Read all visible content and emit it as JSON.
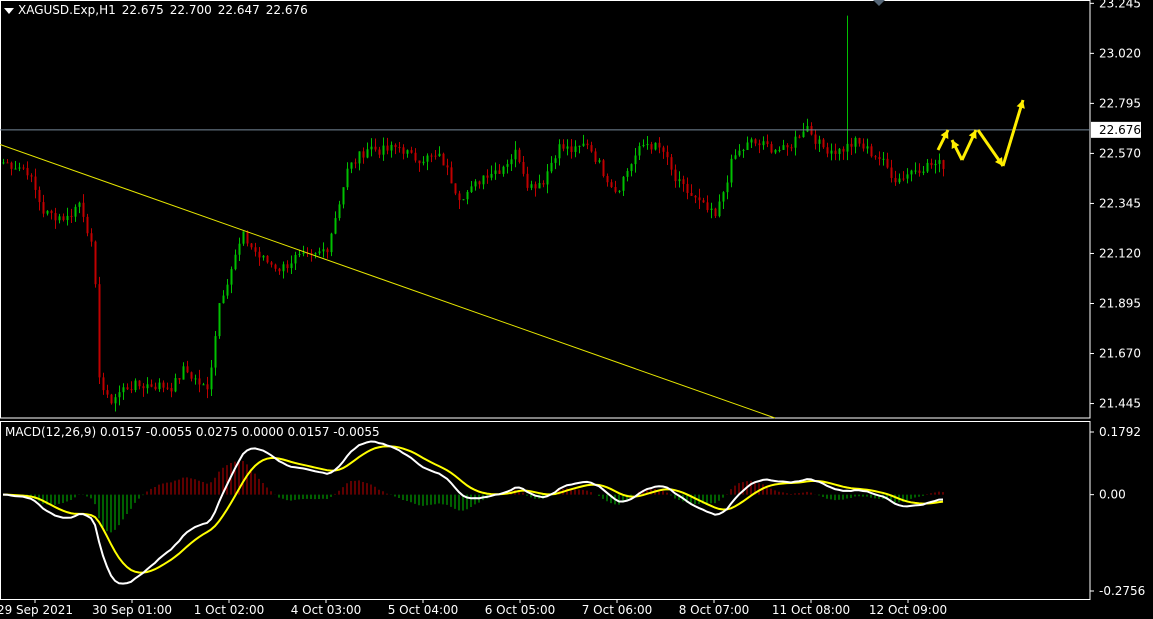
{
  "header": {
    "symbol": "XAGUSD.Exp,H1",
    "open": "22.675",
    "high": "22.700",
    "low": "22.647",
    "close": "22.676"
  },
  "macd_header": "MACD(12,26,9) 0.0157 -0.0055 0.0275 0.0000 0.0157 -0.0055",
  "colors": {
    "background": "#000000",
    "bull": "#00c000",
    "bear": "#c00000",
    "grid": "#ffffff",
    "trendline": "#e6e600",
    "signal": "#ffff00",
    "macd_line": "#ffffff",
    "price_line": "#778899",
    "arrow": "#ffee00"
  },
  "chart_data": [
    {
      "type": "candlestick",
      "title": "XAGUSD.Exp,H1",
      "ylim": [
        21.38,
        23.26
      ],
      "y_ticks": [
        "23.245",
        "23.020",
        "22.795",
        "22.570",
        "22.345",
        "22.120",
        "21.895",
        "21.670",
        "21.445"
      ],
      "current_price": "22.676",
      "x_ticks": [
        "29 Sep 2021",
        "30 Sep 01:00",
        "1 Oct 02:00",
        "4 Oct 03:00",
        "5 Oct 04:00",
        "6 Oct 05:00",
        "7 Oct 06:00",
        "8 Oct 07:00",
        "11 Oct 08:00",
        "12 Oct 09:00"
      ],
      "bar_count": 236,
      "close_path": [
        [
          0,
          22.53
        ],
        [
          8,
          22.5
        ],
        [
          14,
          22.3
        ],
        [
          22,
          22.28
        ],
        [
          26,
          22.35
        ],
        [
          28,
          22.28
        ],
        [
          31,
          22.1
        ],
        [
          33,
          21.55
        ],
        [
          36,
          21.45
        ],
        [
          42,
          21.52
        ],
        [
          50,
          21.53
        ],
        [
          58,
          21.52
        ],
        [
          62,
          21.6
        ],
        [
          66,
          21.55
        ],
        [
          70,
          21.5
        ],
        [
          74,
          21.9
        ],
        [
          78,
          22.05
        ],
        [
          82,
          22.2
        ],
        [
          88,
          22.1
        ],
        [
          95,
          22.05
        ],
        [
          100,
          22.1
        ],
        [
          106,
          22.1
        ],
        [
          111,
          22.15
        ],
        [
          118,
          22.5
        ],
        [
          125,
          22.6
        ],
        [
          130,
          22.58
        ],
        [
          136,
          22.6
        ],
        [
          140,
          22.55
        ],
        [
          150,
          22.55
        ],
        [
          156,
          22.38
        ],
        [
          160,
          22.4
        ],
        [
          165,
          22.48
        ],
        [
          170,
          22.5
        ],
        [
          176,
          22.58
        ],
        [
          180,
          22.42
        ],
        [
          185,
          22.45
        ],
        [
          190,
          22.6
        ],
        [
          196,
          22.58
        ],
        [
          200,
          22.62
        ],
        [
          205,
          22.5
        ],
        [
          210,
          22.4
        ],
        [
          216,
          22.55
        ],
        [
          220,
          22.62
        ],
        [
          226,
          22.58
        ],
        [
          230,
          22.45
        ],
        [
          238,
          22.35
        ],
        [
          244,
          22.28
        ],
        [
          250,
          22.55
        ],
        [
          256,
          22.62
        ],
        [
          262,
          22.6
        ],
        [
          268,
          22.58
        ],
        [
          275,
          22.7
        ],
        [
          280,
          22.6
        ],
        [
          286,
          22.58
        ],
        [
          292,
          22.62
        ],
        [
          300,
          22.55
        ],
        [
          306,
          22.45
        ],
        [
          312,
          22.5
        ],
        [
          318,
          22.52
        ],
        [
          322,
          22.52
        ]
      ]
    },
    {
      "type": "macd",
      "title": "MACD(12,26,9)",
      "values": [
        "0.0157",
        "-0.0055",
        "0.0275",
        "0.0000",
        "0.0157",
        "-0.0055"
      ],
      "ylim": [
        -0.2756,
        0.1792
      ],
      "y_ticks": [
        "0.1792",
        "0.00",
        "-0.2756"
      ]
    }
  ]
}
